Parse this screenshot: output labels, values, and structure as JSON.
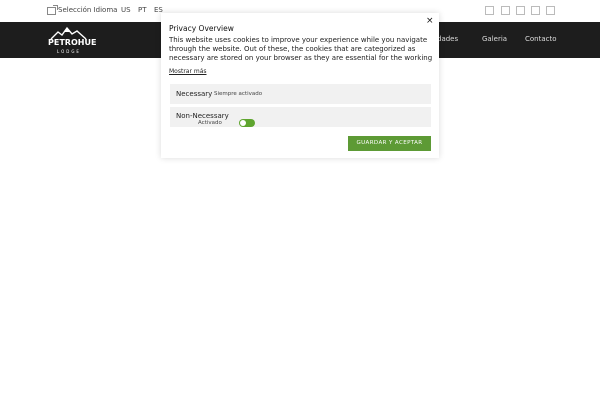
{
  "topbar": {
    "lang_label": "Selección Idioma",
    "languages": [
      "US",
      "PT",
      "ES"
    ],
    "icons": [
      "language-icon",
      "social-icon-1",
      "social-icon-2",
      "social-icon-3",
      "social-icon-4",
      "social-icon-5"
    ]
  },
  "header": {
    "logo_title": "PETROHUE",
    "logo_sub": "LODGE",
    "nav": {
      "visible_partial": "dades",
      "galeria": "Galeria",
      "contacto": "Contacto"
    },
    "colors": {
      "navbar": "#1d1d1d"
    }
  },
  "modal": {
    "title": "Privacy Overview",
    "text": "This website uses cookies to improve your experience while you navigate through the website. Out of these, the cookies that are categorized as necessary are stored on your browser as they are essential for the working c",
    "more_link": "Mostrar más",
    "categories": [
      {
        "title": "Necessary",
        "status": "Siempre activado"
      },
      {
        "title": "Non-Necessary",
        "status": "Activado"
      }
    ],
    "accept_label": "GUARDAR Y ACEPTAR",
    "colors": {
      "accept": "#5d9a35",
      "toggle": "#5fa52f",
      "category_bg": "#f1f1f1"
    }
  }
}
